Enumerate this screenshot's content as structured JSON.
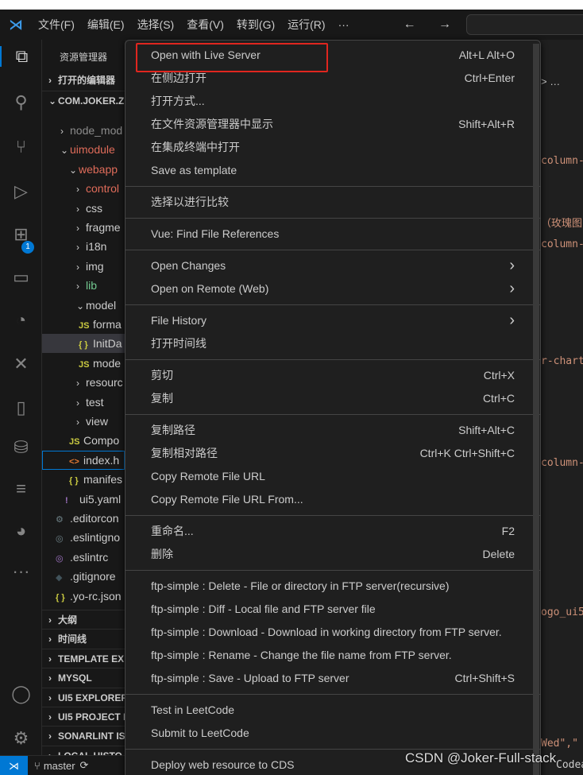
{
  "titlebar": {
    "menus": [
      "文件(F)",
      "编辑(E)",
      "选择(S)",
      "查看(V)",
      "转到(G)",
      "运行(R)",
      "···"
    ],
    "nav": "← →"
  },
  "activity": {
    "icons": [
      "files-icon",
      "search-icon",
      "source-control-icon",
      "run-debug-icon",
      "extensions-icon",
      "remote-explorer-icon",
      "git-graph-icon",
      "tools-icon",
      "bookmark-icon",
      "database-icon",
      "sql-icon",
      "sonar-icon",
      "more-icon",
      "account-icon",
      "settings-icon"
    ],
    "extensions_badge": "1"
  },
  "sidebar": {
    "title": "资源管理器",
    "open_editors": "打开的编辑器",
    "project": "COM.JOKER.Z",
    "tree": [
      {
        "chev": "›",
        "label": "node_mod",
        "cls": "gray",
        "indent": 23
      },
      {
        "chev": "⌄",
        "label": "uimodule",
        "cls": "red",
        "indent": 23
      },
      {
        "chev": "⌄",
        "label": "webapp",
        "cls": "red",
        "indent": 34
      },
      {
        "chev": "›",
        "label": "control",
        "cls": "red",
        "indent": 43
      },
      {
        "chev": "›",
        "label": "css",
        "indent": 43
      },
      {
        "chev": "›",
        "label": "fragme",
        "indent": 43
      },
      {
        "chev": "›",
        "label": "i18n",
        "indent": 43
      },
      {
        "chev": "›",
        "label": "img",
        "indent": 43
      },
      {
        "chev": "›",
        "label": "lib",
        "cls": "green",
        "indent": 43
      },
      {
        "chev": "⌄",
        "label": "model",
        "indent": 43
      },
      {
        "icon": "JS",
        "label": "forma",
        "indent": 46
      },
      {
        "icon": "{ }",
        "label": "InitDa",
        "indent": 46,
        "sel": true
      },
      {
        "icon": "JS",
        "label": "mode",
        "indent": 46
      },
      {
        "chev": "›",
        "label": "resourc",
        "indent": 43
      },
      {
        "chev": "›",
        "label": "test",
        "indent": 43
      },
      {
        "chev": "›",
        "label": "view",
        "indent": 43
      },
      {
        "icon": "JS",
        "label": "Compo",
        "indent": 34
      },
      {
        "icon": "<>",
        "label": "index.h",
        "indent": 34,
        "focus": true,
        "iconColor": "#e37933"
      },
      {
        "icon": "{ }",
        "label": "manifes",
        "indent": 34
      },
      {
        "icon": "!",
        "label": "ui5.yaml",
        "indent": 29,
        "iconColor": "#a074c4"
      },
      {
        "icon": "⚙",
        "label": ".editorcon",
        "indent": 17,
        "iconColor": "#6d8086"
      },
      {
        "icon": "◎",
        "label": ".eslintigno",
        "indent": 17,
        "iconColor": "#6d8086"
      },
      {
        "icon": "◎",
        "label": ".eslintrc",
        "indent": 17,
        "iconColor": "#a074c4"
      },
      {
        "icon": "◆",
        "label": ".gitignore",
        "indent": 17,
        "iconColor": "#41535b"
      },
      {
        "icon": "{ }",
        "label": ".yo-rc.json",
        "indent": 17
      }
    ],
    "sections": [
      "大纲",
      "时间线",
      "TEMPLATE EX",
      "MYSQL",
      "UI5 EXPLORER",
      "UI5 PROJECT I",
      "SONARLINT IS",
      "LOCAL HISTO"
    ]
  },
  "status": {
    "branch": "master"
  },
  "editor": {
    "lines": [
      "> …",
      "column-",
      "（玫瑰图",
      "column-",
      "r-chart",
      "column-",
      "ogo_ui5",
      "Wed\",\"",
      "Codea"
    ]
  },
  "context_menu": {
    "groups": [
      [
        {
          "label": "Open with Live Server",
          "shortcut": "Alt+L Alt+O",
          "highlighted": true
        },
        {
          "label": "在侧边打开",
          "shortcut": "Ctrl+Enter"
        },
        {
          "label": "打开方式..."
        },
        {
          "label": "在文件资源管理器中显示",
          "shortcut": "Shift+Alt+R"
        },
        {
          "label": "在集成终端中打开"
        },
        {
          "label": "Save as template"
        }
      ],
      [
        {
          "label": "选择以进行比较"
        }
      ],
      [
        {
          "label": "Vue: Find File References"
        }
      ],
      [
        {
          "label": "Open Changes",
          "submenu": true
        },
        {
          "label": "Open on Remote (Web)",
          "submenu": true
        }
      ],
      [
        {
          "label": "File History",
          "submenu": true
        },
        {
          "label": "打开时间线"
        }
      ],
      [
        {
          "label": "剪切",
          "shortcut": "Ctrl+X"
        },
        {
          "label": "复制",
          "shortcut": "Ctrl+C"
        }
      ],
      [
        {
          "label": "复制路径",
          "shortcut": "Shift+Alt+C"
        },
        {
          "label": "复制相对路径",
          "shortcut": "Ctrl+K Ctrl+Shift+C"
        },
        {
          "label": "Copy Remote File URL"
        },
        {
          "label": "Copy Remote File URL From..."
        }
      ],
      [
        {
          "label": "重命名...",
          "shortcut": "F2"
        },
        {
          "label": "删除",
          "shortcut": "Delete"
        }
      ],
      [
        {
          "label": "ftp-simple : Delete - File or directory in FTP server(recursive)"
        },
        {
          "label": "ftp-simple : Diff - Local file and FTP server file"
        },
        {
          "label": "ftp-simple : Download - Download in working directory from FTP server."
        },
        {
          "label": "ftp-simple : Rename - Change the file name from FTP server."
        },
        {
          "label": "ftp-simple : Save - Upload to FTP server",
          "shortcut": "Ctrl+Shift+S"
        }
      ],
      [
        {
          "label": "Test in LeetCode"
        },
        {
          "label": "Submit to LeetCode"
        }
      ],
      [
        {
          "label": "Deploy web resource to CDS"
        }
      ]
    ]
  },
  "watermark": "CSDN @Joker-Full-stack",
  "colors": {
    "accent": "#0078d4",
    "highlight_box": "#e0261f",
    "folder_modified": "#e06c5a",
    "folder_untracked": "#73c991"
  }
}
